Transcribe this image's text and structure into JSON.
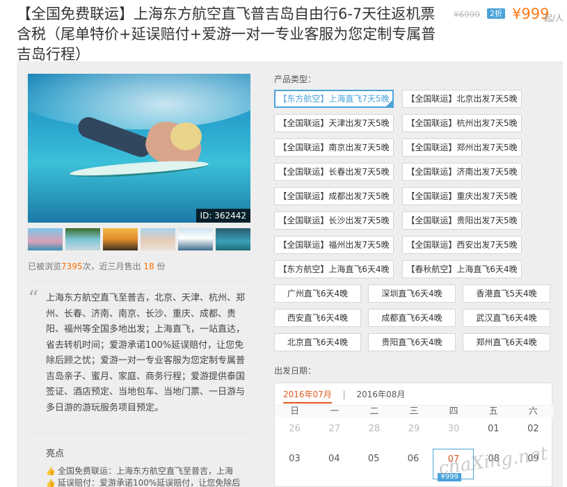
{
  "product": {
    "title": "【全国免费联运】上海东方航空直飞普吉岛自由行6-7天往返机票含税（尾单特价+延误赔付+爱游一对一专业客服为您定制专属普吉岛行程）",
    "old_price": "¥6999",
    "discount": "2折",
    "price": "¥999",
    "price_unit": "起/人"
  },
  "gallery": {
    "image_id": "ID: 362442",
    "thumbnails": [
      "beach-group",
      "waterfall",
      "sunset",
      "beach-friends",
      "boat",
      "diving"
    ]
  },
  "stats": {
    "prefix": "已被浏览",
    "views": "7395",
    "middle": "次，近三月售出",
    "sold": "18",
    "suffix": "份"
  },
  "description": {
    "text": "上海东方航空直飞至普吉，北京、天津、杭州、郑州、长春、济南、南京、长沙、重庆、成都、贵阳、福州等全国多地出发；上海直飞，一站直达，省去转机时间；爱游承诺100%延误赔付，让您免除后顾之忧；爱游一对一专业客服为您定制专属普吉岛亲子、蜜月、家庭、商务行程；爱游提供泰国签证、酒店预定、当地包车、当地门票、一日游与多日游的游玩服务项目预定。"
  },
  "highlights": {
    "title": "亮点",
    "items": [
      "全国免费联运：上海东方航空直飞至普吉，上海",
      "延误赔付：爱游承诺100%延误赔付，让您免除后"
    ]
  },
  "product_type": {
    "label": "产品类型：",
    "options": [
      "【东方航空】上海直飞7天5晚",
      "【全国联运】北京出发7天5晚",
      "【全国联运】天津出发7天5晚",
      "【全国联运】杭州出发7天5晚",
      "【全国联运】南京出发7天5晚",
      "【全国联运】郑州出发7天5晚",
      "【全国联运】长春出发7天5晚",
      "【全国联运】济南出发7天5晚",
      "【全国联运】成都出发7天5晚",
      "【全国联运】重庆出发7天5晚",
      "【全国联运】长沙出发7天5晚",
      "【全国联运】贵阳出发7天5晚",
      "【全国联运】福州出发7天5晚",
      "【全国联运】西安出发7天5晚",
      "【东方航空】上海直飞6天4晚",
      "【春秋航空】上海直飞6天4晚"
    ],
    "short_options": [
      "广州直飞6天4晚",
      "深圳直飞6天4晚",
      "香港直飞5天4晚",
      "西安直飞6天4晚",
      "成都直飞6天4晚",
      "武汉直飞6天4晚",
      "北京直飞6天4晚",
      "贵阳直飞6天4晚",
      "郑州直飞6天4晚"
    ],
    "selected_index": 0
  },
  "departure": {
    "label": "出发日期：",
    "months": [
      "2016年07月",
      "2016年08月"
    ],
    "month_separator": "|",
    "weekdays": [
      "日",
      "一",
      "二",
      "三",
      "四",
      "五",
      "六"
    ],
    "week1": [
      "26",
      "27",
      "28",
      "29",
      "30",
      "01",
      "02"
    ],
    "week2": [
      "03",
      "04",
      "05",
      "06",
      "07",
      "08",
      "09"
    ],
    "today_price": "¥999"
  },
  "watermark": "chaXing.net",
  "colors": {
    "accent_blue": "#4aa3d9",
    "price_orange": "#ff7a1a",
    "active_month": "#e05a1e"
  }
}
